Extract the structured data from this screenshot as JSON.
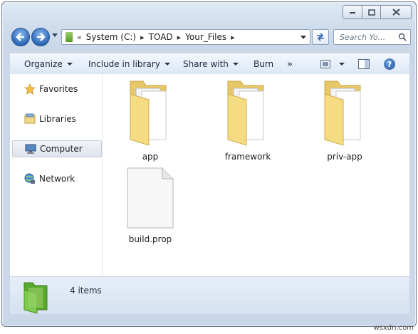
{
  "window": {
    "caption_buttons": {
      "minimize": "—",
      "maximize": "□",
      "close": "✕"
    }
  },
  "address_bar": {
    "overflow_marker": "«",
    "breadcrumbs": [
      "System (C:)",
      "TOAD",
      "Your_Files"
    ],
    "separator": "▸"
  },
  "search": {
    "placeholder": "Search Yo..."
  },
  "toolbar": {
    "organize": "Organize",
    "include_in_library": "Include in library",
    "share_with": "Share with",
    "burn": "Burn",
    "more": "»",
    "help": "?"
  },
  "nav_pane": {
    "items": [
      {
        "label": "Favorites",
        "icon": "star-icon"
      },
      {
        "label": "Libraries",
        "icon": "libraries-icon"
      },
      {
        "label": "Computer",
        "icon": "computer-icon",
        "selected": true
      },
      {
        "label": "Network",
        "icon": "network-icon"
      }
    ]
  },
  "files": [
    {
      "name": "app",
      "type": "folder"
    },
    {
      "name": "framework",
      "type": "folder"
    },
    {
      "name": "priv-app",
      "type": "folder"
    },
    {
      "name": "build.prop",
      "type": "file"
    }
  ],
  "status_bar": {
    "item_count": "4 items"
  },
  "watermark": "wsxdn.com",
  "colors": {
    "folder": "#f2d67e",
    "library_folder": "#6dbb3c",
    "selection": "#dde4ed"
  }
}
